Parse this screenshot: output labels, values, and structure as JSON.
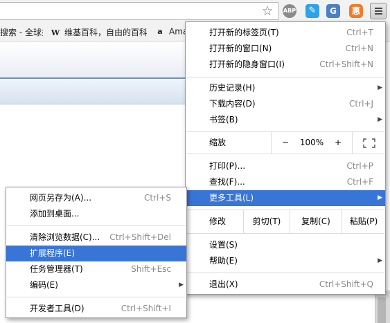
{
  "toolbar": {
    "extensions": [
      {
        "name": "abp-icon",
        "glyph": "ABP",
        "color": "#8b8b8b"
      },
      {
        "name": "pen-icon",
        "glyph": "✎",
        "color": "#2ea3e8"
      },
      {
        "name": "translate-icon",
        "glyph": "G",
        "color": "#4a80c8"
      },
      {
        "name": "you-icon",
        "glyph": "惠",
        "color": "#f07c2a"
      }
    ]
  },
  "bookmarks": [
    {
      "label": "搜索 - 全球排",
      "icon": ""
    },
    {
      "label": "维基百科，自由的百科",
      "icon": "W"
    },
    {
      "label": "Ama",
      "icon": "a"
    }
  ],
  "main_menu": {
    "new_tab": {
      "label": "打开新的标签页(T)",
      "shortcut": "Ctrl+T"
    },
    "new_window": {
      "label": "打开新的窗口(N)",
      "shortcut": "Ctrl+N"
    },
    "new_incognito": {
      "label": "打开新的隐身窗口(I)",
      "shortcut": "Ctrl+Shift+N"
    },
    "history": {
      "label": "历史记录(H)"
    },
    "downloads": {
      "label": "下载内容(D)",
      "shortcut": "Ctrl+J"
    },
    "bookmarks": {
      "label": "书签(B)"
    },
    "zoom": {
      "label": "缩放",
      "minus": "−",
      "value": "100%",
      "plus": "+"
    },
    "print": {
      "label": "打印(P)...",
      "shortcut": "Ctrl+P"
    },
    "find": {
      "label": "查找(F)...",
      "shortcut": "Ctrl+F"
    },
    "more_tools": {
      "label": "更多工具(L)"
    },
    "edit": {
      "label": "修改",
      "cut": "剪切(T)",
      "copy": "复制(C)",
      "paste": "粘贴(P)"
    },
    "settings": {
      "label": "设置(S)"
    },
    "help": {
      "label": "帮助(E)"
    },
    "exit": {
      "label": "退出(X)",
      "shortcut": "Ctrl+Shift+Q"
    }
  },
  "sub_menu": {
    "save_page": {
      "label": "网页另存为(A)...",
      "shortcut": "Ctrl+S"
    },
    "add_to_desktop": {
      "label": "添加到桌面..."
    },
    "clear_data": {
      "label": "清除浏览数据(C)...",
      "shortcut": "Ctrl+Shift+Del"
    },
    "extensions": {
      "label": "扩展程序(E)"
    },
    "task_manager": {
      "label": "任务管理器(T)",
      "shortcut": "Shift+Esc"
    },
    "encoding": {
      "label": "编码(E)"
    },
    "dev_tools": {
      "label": "开发者工具(D)",
      "shortcut": "Ctrl+Shift+I"
    }
  },
  "colors": {
    "highlight": "#3875d7"
  }
}
